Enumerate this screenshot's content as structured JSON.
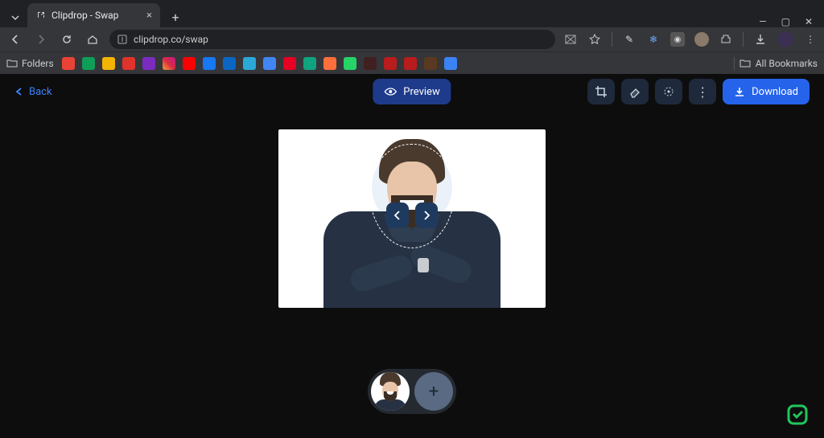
{
  "browser": {
    "tab_title": "Clipdrop - Swap",
    "url": "clipdrop.co/swap",
    "folders_label": "Folders",
    "all_bookmarks_label": "All Bookmarks",
    "bookmark_icons": [
      {
        "name": "gmail",
        "bg": "#ea4335"
      },
      {
        "name": "drive",
        "bg": "#0f9d58"
      },
      {
        "name": "bookmark-app",
        "bg": "#f4b400"
      },
      {
        "name": "app-red",
        "bg": "#e0332c"
      },
      {
        "name": "app-x",
        "bg": "#7b2cbf"
      },
      {
        "name": "instagram",
        "bg": "linear-gradient(45deg,#f09433,#e6683c,#dc2743,#cc2366,#bc1888)"
      },
      {
        "name": "youtube",
        "bg": "#ff0000"
      },
      {
        "name": "facebook",
        "bg": "#1877f2"
      },
      {
        "name": "linkedin",
        "bg": "#0a66c2"
      },
      {
        "name": "app-cyan",
        "bg": "#2aa8d8"
      },
      {
        "name": "app-blue",
        "bg": "#4285f4"
      },
      {
        "name": "pinterest",
        "bg": "#e60023"
      },
      {
        "name": "app-teal",
        "bg": "#10a37f"
      },
      {
        "name": "app-orange",
        "bg": "#ff6f3c"
      },
      {
        "name": "whatsapp",
        "bg": "#25d366"
      },
      {
        "name": "app-dark",
        "bg": "#402020"
      },
      {
        "name": "chili-1",
        "bg": "#b91c1c"
      },
      {
        "name": "chili-2",
        "bg": "#b91c1c"
      },
      {
        "name": "app-20",
        "bg": "#5b3920"
      },
      {
        "name": "sparkle",
        "bg": "#3b82f6"
      }
    ]
  },
  "app": {
    "back_label": "Back",
    "preview_label": "Preview",
    "download_label": "Download",
    "add_face_label": "+"
  }
}
